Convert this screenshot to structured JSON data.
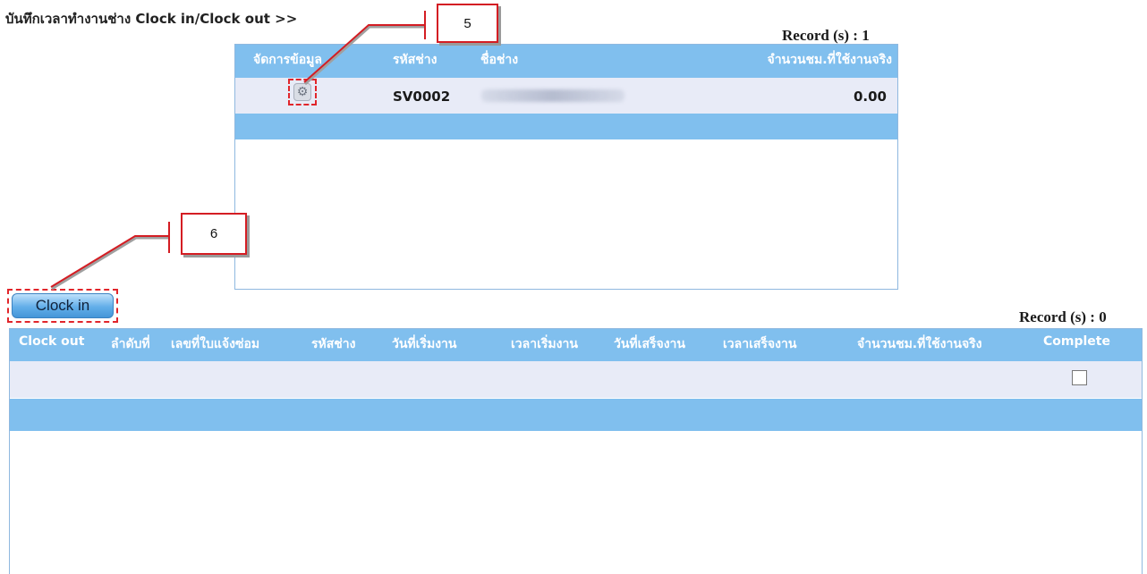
{
  "page_title": "บันทึกเวลาทำงานช่าง Clock in/Clock out >>",
  "technician_table": {
    "record_count": "Record (s) : 1",
    "headers": {
      "manage": "จัดการข้อมูล",
      "tech_code": "รหัสช่าง",
      "tech_name": "ชื่อช่าง",
      "hours": "จำนวนชม.ที่ใช้งานจริง"
    },
    "rows": [
      {
        "tech_code": "SV0002",
        "hours": "0.00"
      }
    ]
  },
  "clock_in_button": "Clock in",
  "clock_table": {
    "record_count": "Record (s) : 0",
    "headers": {
      "clock_out": "Clock out",
      "seq": "ลำดับที่",
      "ticket_no": "เลขที่ใบแจ้งซ่อม",
      "tech_code": "รหัสช่าง",
      "start_date": "วันที่เริ่มงาน",
      "start_time": "เวลาเริ่มงาน",
      "end_date": "วันที่เสร็จงาน",
      "end_time": "เวลาเสร็จงาน",
      "hours": "จำนวนชม.ที่ใช้งานจริง",
      "complete": "Complete"
    }
  },
  "callouts": {
    "five": "5",
    "six": "6"
  },
  "icons": {
    "manage": "gear-icon"
  },
  "colors": {
    "header_bg": "#80bfee",
    "row_bg": "#e8ebf7",
    "callout_border": "#d41d23"
  }
}
